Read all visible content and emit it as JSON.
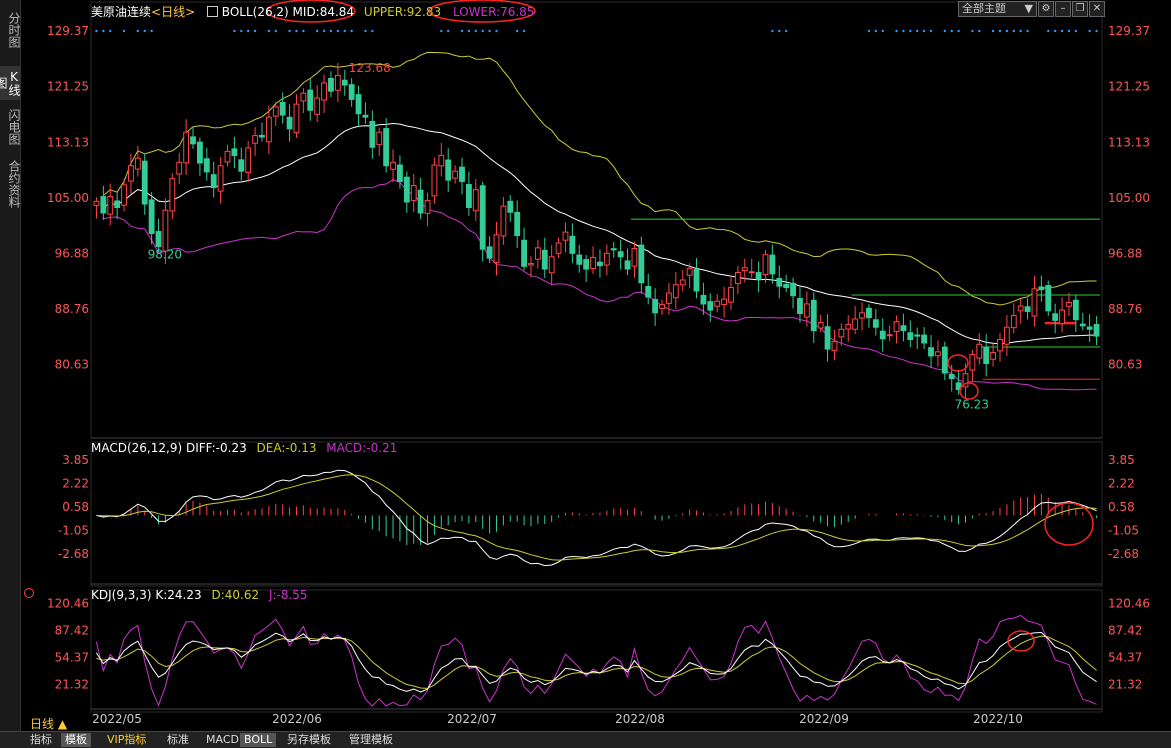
{
  "sidebar": {
    "tabs": [
      {
        "label": "分时图",
        "active": false
      },
      {
        "label": "K线图",
        "active": true
      },
      {
        "label": "闪电图",
        "active": false
      },
      {
        "label": "合约资料",
        "active": false
      }
    ]
  },
  "header": {
    "symbol": "美原油连续",
    "period": "<日线>",
    "boll_label": "BOLL(26,2)",
    "mid": "MID:84.84",
    "upper": "UPPER:92.83",
    "lower": "LOWER:76.85",
    "theme_label": "全部主题"
  },
  "macd_header": {
    "name": "MACD(26,12,9)",
    "diff": "DIFF:-0.23",
    "dea": "DEA:-0.13",
    "macd": "MACD:-0.21"
  },
  "kdj_header": {
    "name": "KDJ(9,3,3)",
    "k": "K:24.23",
    "d": "D:40.62",
    "j": "J:-8.55"
  },
  "period_button": "日线 ▲",
  "bottom_tabs": [
    {
      "label": "指标",
      "active": false
    },
    {
      "label": "模板",
      "active": true
    },
    {
      "label": "VIP指标",
      "active": false,
      "color": "#ffcc33"
    },
    {
      "label": "标准",
      "active": false
    },
    {
      "label": "MACD",
      "active": false
    },
    {
      "label": "BOLL",
      "active": true
    },
    {
      "label": "另存模板",
      "active": false
    },
    {
      "label": "管理模板",
      "active": false
    }
  ],
  "colors": {
    "up": "#ff4444",
    "down": "#33cc99",
    "mid_line": "#ffffff",
    "upper_line": "#cccc33",
    "lower_line": "#cc33cc",
    "axis_text": "#ff5555",
    "date_text": "#cccccc",
    "annotation_red": "#ff2222",
    "level_green": "#33cc33"
  },
  "chart_data": [
    {
      "type": "candlestick",
      "title": "美原油连续 <日线>",
      "x_ticks": [
        "2022/05",
        "2022/06",
        "2022/07",
        "2022/08",
        "2022/09",
        "2022/10"
      ],
      "y_ticks": [
        129.37,
        121.25,
        113.13,
        105.0,
        96.88,
        88.76,
        80.63
      ],
      "ylim": [
        74.0,
        131.0
      ],
      "annotations": [
        {
          "label": "123.68",
          "value": 123.68,
          "bar": 36
        },
        {
          "label": "98.20",
          "value": 98.2,
          "bar": 8
        },
        {
          "label": "76.23",
          "value": 76.23,
          "bar": 125
        }
      ],
      "horizontal_levels": [
        {
          "value": 101.9,
          "from_bar": 78,
          "color": "green"
        },
        {
          "value": 90.8,
          "from_bar": 110,
          "color": "green"
        },
        {
          "value": 83.2,
          "from_bar": 128,
          "color": "green"
        },
        {
          "value": 78.5,
          "from_bar": 129,
          "color": "red"
        },
        {
          "value": 86.7,
          "from_bar": 138,
          "to_bar": 142,
          "color": "red"
        }
      ],
      "closes": [
        104.5,
        102.8,
        105.2,
        103.6,
        106.9,
        109.7,
        110.8,
        104.1,
        99.8,
        97.9,
        103.2,
        107.8,
        110.2,
        114.6,
        112.9,
        110.1,
        108.8,
        106.5,
        109.7,
        111.8,
        111.2,
        108.9,
        112.3,
        114.1,
        113.9,
        116.8,
        118.3,
        117.1,
        115.1,
        118.7,
        120.3,
        117.8,
        119.6,
        121.8,
        120.6,
        122.9,
        121.5,
        119.4,
        117.3,
        116.8,
        112.4,
        114.6,
        109.7,
        110.2,
        107.4,
        104.4,
        106.8,
        102.8,
        104.6,
        109.8,
        111.2,
        107.6,
        108.9,
        107.4,
        103.6,
        106.2,
        97.5,
        96.2,
        99.6,
        103.8,
        102.9,
        99.5,
        95.0,
        95.4,
        97.7,
        94.6,
        96.4,
        98.4,
        100.0,
        96.9,
        95.3,
        94.6,
        96.3,
        95.1,
        96.9,
        97.4,
        96.4,
        94.6,
        97.6,
        92.6,
        90.5,
        88.2,
        89.4,
        91.1,
        92.3,
        93.0,
        94.7,
        91.4,
        89.5,
        88.6,
        89.9,
        90.2,
        91.9,
        94.1,
        94.8,
        94.2,
        93.1,
        96.7,
        93.9,
        92.1,
        91.9,
        90.7,
        88.1,
        89.5,
        85.6,
        86.8,
        82.9,
        84.0,
        85.8,
        86.5,
        87.3,
        88.2,
        87.5,
        86.1,
        84.4,
        85.0,
        86.9,
        85.6,
        84.3,
        84.8,
        83.8,
        81.9,
        82.5,
        79.4,
        78.6,
        77.0,
        79.3,
        82.1,
        83.6,
        80.8,
        82.4,
        84.3,
        86.1,
        87.8,
        89.2,
        88.4,
        91.7,
        91.6,
        88.5,
        87.1,
        88.6,
        89.7,
        87.2,
        86.3,
        85.8,
        84.8
      ],
      "bollinger": {
        "mid": 84.84,
        "upper": 92.83,
        "lower": 76.85
      }
    },
    {
      "type": "bar_line",
      "title": "MACD(26,12,9)",
      "y_ticks": [
        3.85,
        2.22,
        0.58,
        -1.05,
        -2.68
      ],
      "ylim": [
        -4.5,
        4.0
      ],
      "last": {
        "diff": -0.23,
        "dea": -0.13,
        "macd": -0.21
      }
    },
    {
      "type": "line",
      "title": "KDJ(9,3,3)",
      "y_ticks": [
        120.46,
        87.42,
        54.37,
        21.32
      ],
      "ylim": [
        -5,
        125
      ],
      "last": {
        "k": 24.23,
        "d": 40.62,
        "j": -8.55
      }
    }
  ]
}
